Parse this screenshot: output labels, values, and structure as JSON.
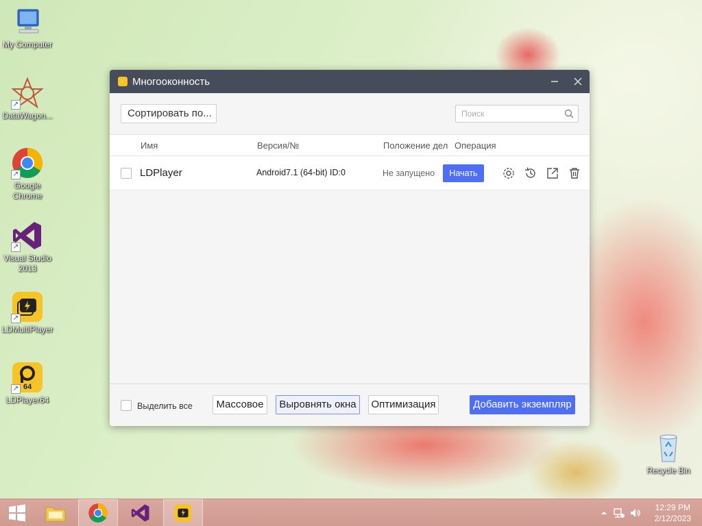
{
  "desktop": {
    "icons": [
      {
        "label": "My Computer"
      },
      {
        "label": "DataWagon..."
      },
      {
        "label": "Google Chrome"
      },
      {
        "label": "Visual Studio 2013"
      },
      {
        "label": "LDMultiPlayer"
      },
      {
        "label": "LDPlayer64"
      },
      {
        "label": "Recycle Bin"
      }
    ],
    "ldplayer_badge": "64"
  },
  "window": {
    "title": "Многооконность",
    "toolbar": {
      "sort_label": "Сортировать по...",
      "search_placeholder": "Поиск"
    },
    "columns": {
      "name": "Имя",
      "version": "Версия/№",
      "status": "Положение дел",
      "operation": "Операция"
    },
    "rows": [
      {
        "name": "LDPlayer",
        "version": "Android7.1 (64-bit) ID:0",
        "status": "Не запущено",
        "start_label": "Начать"
      }
    ],
    "footer": {
      "select_all": "Выделить все",
      "bulk_label": "Массовое",
      "arrange_label": "Выровнять окна",
      "optimize_label": "Оптимизация",
      "add_label": "Добавить экземпляр"
    }
  },
  "taskbar": {
    "time": "12:29 PM",
    "date": "2/12/2023"
  },
  "colors": {
    "accent": "#4d6ef5",
    "titlebar": "#464c5a",
    "brand_yellow": "#f7c326"
  }
}
